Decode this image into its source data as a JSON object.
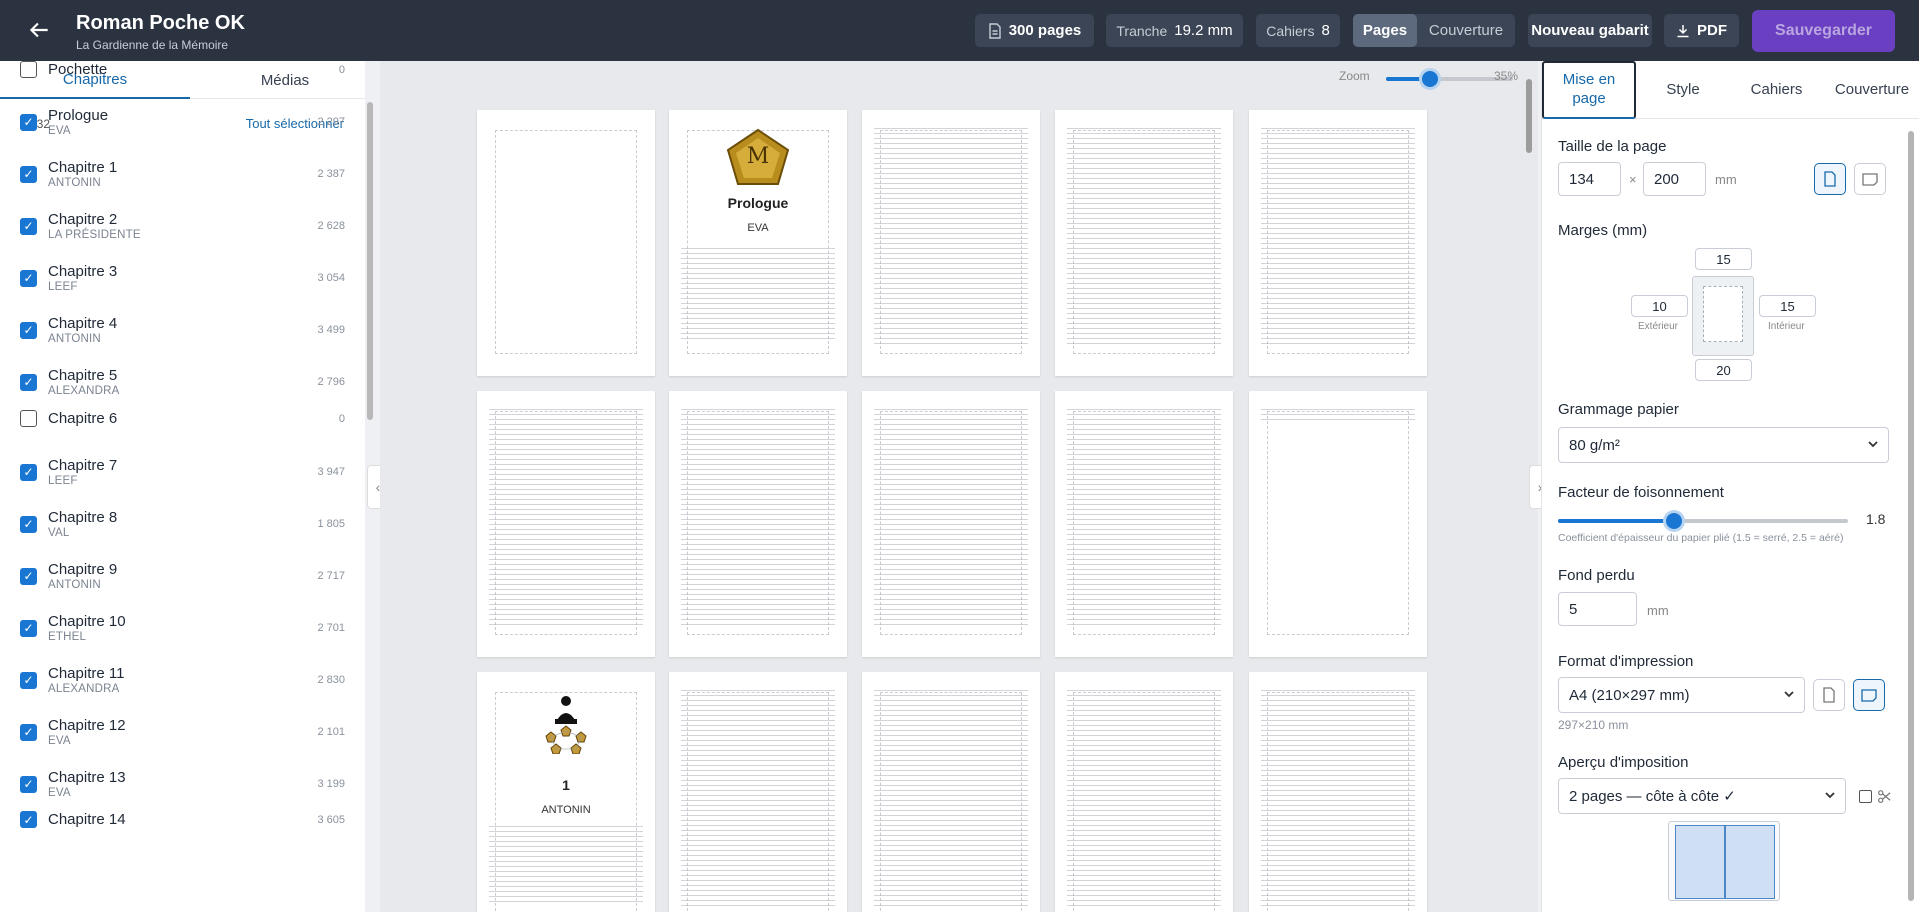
{
  "header": {
    "title": "Roman Poche OK",
    "subtitle": "La Gardienne de la Mémoire",
    "pages": "300 pages",
    "tranche_label": "Tranche",
    "tranche_value": "19.2 mm",
    "cahiers_label": "Cahiers",
    "cahiers_value": "8",
    "view_pages": "Pages",
    "view_couverture": "Couverture",
    "new_template": "Nouveau gabarit",
    "pdf": "PDF",
    "save": "Sauvegarder"
  },
  "sidebar": {
    "tabs": [
      "Chapitres",
      "Médias"
    ],
    "selected_count": "23/32",
    "select_all": "Tout sélectionner",
    "chapters": [
      {
        "title": "Pochette",
        "sub": "",
        "count": "0",
        "checked": false
      },
      {
        "title": "Prologue",
        "sub": "EVA",
        "count": "2 297",
        "checked": true
      },
      {
        "title": "Chapitre 1",
        "sub": "ANTONIN",
        "count": "2 387",
        "checked": true
      },
      {
        "title": "Chapitre 2",
        "sub": "LA PRÉSIDENTE",
        "count": "2 628",
        "checked": true
      },
      {
        "title": "Chapitre 3",
        "sub": "LEEF",
        "count": "3 054",
        "checked": true
      },
      {
        "title": "Chapitre 4",
        "sub": "ANTONIN",
        "count": "3 499",
        "checked": true
      },
      {
        "title": "Chapitre 5",
        "sub": "ALEXANDRA",
        "count": "2 796",
        "checked": true
      },
      {
        "title": "Chapitre 6",
        "sub": "",
        "count": "0",
        "checked": false
      },
      {
        "title": "Chapitre 7",
        "sub": "LEEF",
        "count": "3 947",
        "checked": true
      },
      {
        "title": "Chapitre 8",
        "sub": "VAL",
        "count": "1 805",
        "checked": true
      },
      {
        "title": "Chapitre 9",
        "sub": "ANTONIN",
        "count": "2 717",
        "checked": true
      },
      {
        "title": "Chapitre 10",
        "sub": "ETHEL",
        "count": "2 701",
        "checked": true
      },
      {
        "title": "Chapitre 11",
        "sub": "ALEXANDRA",
        "count": "2 830",
        "checked": true
      },
      {
        "title": "Chapitre 12",
        "sub": "EVA",
        "count": "2 101",
        "checked": true
      },
      {
        "title": "Chapitre 13",
        "sub": "EVA",
        "count": "3 199",
        "checked": true
      },
      {
        "title": "Chapitre 14",
        "sub": "",
        "count": "3 605",
        "checked": true
      }
    ]
  },
  "canvas": {
    "zoom_label": "Zoom",
    "zoom_value": "35%",
    "zoom_fraction": 0.35,
    "prologue_letter": "M",
    "prologue_title": "Prologue",
    "prologue_sub": "EVA",
    "chapter1_number": "1",
    "chapter1_sub": "ANTONIN"
  },
  "panel": {
    "tabs": [
      "Mise en page",
      "Style",
      "Cahiers",
      "Couverture"
    ],
    "page_size_label": "Taille de la page",
    "page_width": "134",
    "page_x": "×",
    "page_height": "200",
    "unit_mm": "mm",
    "margins_label": "Marges (mm)",
    "margin_top": "15",
    "margin_outer": "10",
    "margin_outer_label": "Extérieur",
    "margin_inner": "15",
    "margin_inner_label": "Intérieur",
    "margin_bottom": "20",
    "paper_label": "Grammage papier",
    "paper_value": "80 g/m²",
    "bulk_label": "Facteur de foisonnement",
    "bulk_value": "1.8",
    "bulk_help": "Coefficient d'épaisseur du papier plié (1.5 = serré, 2.5 = aéré)",
    "bleed_label": "Fond perdu",
    "bleed_value": "5",
    "print_format_label": "Format d'impression",
    "print_format_value": "A4 (210×297 mm)",
    "print_format_dims": "297×210 mm",
    "imposition_label": "Aperçu d'imposition",
    "imposition_value": "2 pages — côte à côte ✓"
  },
  "colors": {
    "header": "#2b3341",
    "accent": "#1976d2",
    "save": "#6a3fc1"
  }
}
